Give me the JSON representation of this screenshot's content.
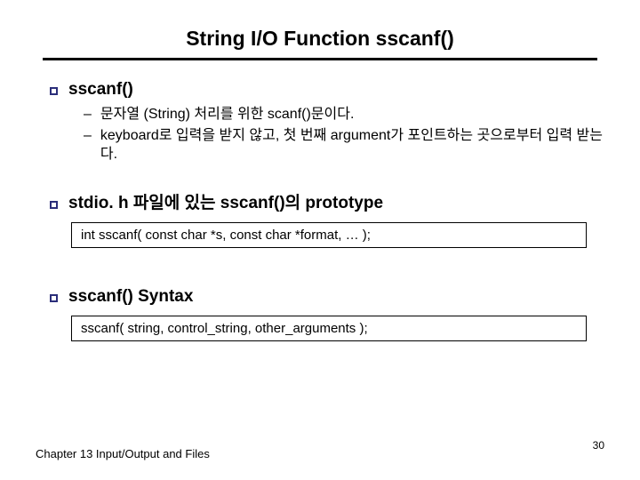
{
  "title": "String I/O Function sscanf()",
  "section1": {
    "heading": "sscanf()",
    "sub1": "문자열 (String) 처리를 위한 scanf()문이다.",
    "sub2": "keyboard로 입력을 받지 않고, 첫 번째 argument가 포인트하는 곳으로부터 입력 받는다."
  },
  "section2": {
    "heading": "stdio. h 파일에 있는 sscanf()의 prototype",
    "code": "int sscanf( const char *s, const char *format, … );"
  },
  "section3": {
    "heading": "sscanf() Syntax",
    "code": "sscanf( string, control_string, other_arguments );"
  },
  "footer": "Chapter 13  Input/Output and Files",
  "pageNumber": "30"
}
